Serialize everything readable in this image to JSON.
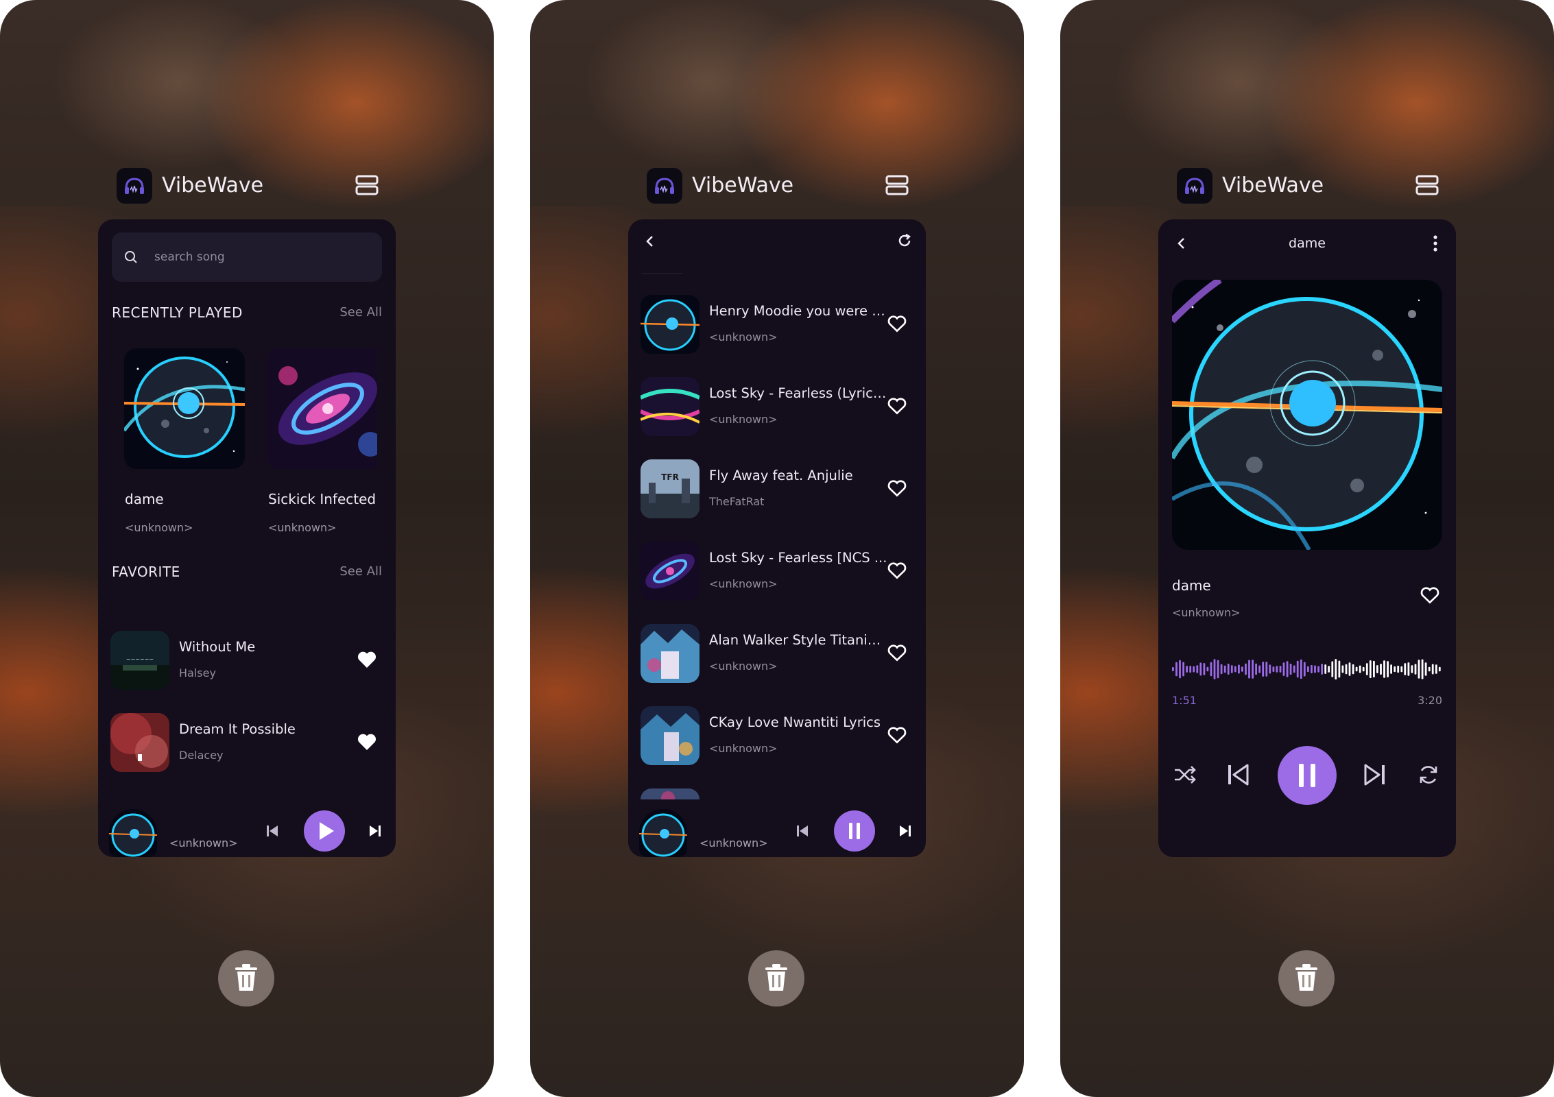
{
  "app": {
    "name": "VibeWave",
    "accent": "#9c6be6"
  },
  "screen1": {
    "search": {
      "placeholder": "search song"
    },
    "recently_played": {
      "title": "RECENTLY PLAYED",
      "see_all": "See All",
      "items": [
        {
          "title": "dame",
          "artist": "<unknown>"
        },
        {
          "title": "Sickick  Infected",
          "artist": "<unknown>"
        }
      ]
    },
    "favorite": {
      "title": "FAVORITE",
      "see_all": "See All",
      "items": [
        {
          "title": "Without Me",
          "artist": "Halsey"
        },
        {
          "title": "Dream It Possible",
          "artist": "Delacey"
        }
      ]
    },
    "mini_player": {
      "artist": "<unknown>",
      "state": "paused"
    }
  },
  "screen2": {
    "songs": [
      {
        "title": "Henry Moodie  you were t...",
        "artist": "<unknown>"
      },
      {
        "title": "Lost Sky - Fearless (Lyrics...",
        "artist": "<unknown>"
      },
      {
        "title": "Fly Away feat. Anjulie",
        "artist": "TheFatRat"
      },
      {
        "title": "Lost Sky - Fearless [NCS ...",
        "artist": "<unknown>"
      },
      {
        "title": "Alan Walker Style  Titanic...",
        "artist": "<unknown>"
      },
      {
        "title": "CKay  Love Nwantiti Lyrics",
        "artist": "<unknown>"
      }
    ],
    "mini_player": {
      "artist": "<unknown>",
      "state": "playing"
    }
  },
  "screen3": {
    "header_title": "dame",
    "song": {
      "title": "dame",
      "artist": "<unknown>"
    },
    "elapsed": "1:51",
    "duration": "3:20",
    "progress": 0.555,
    "state": "playing"
  }
}
